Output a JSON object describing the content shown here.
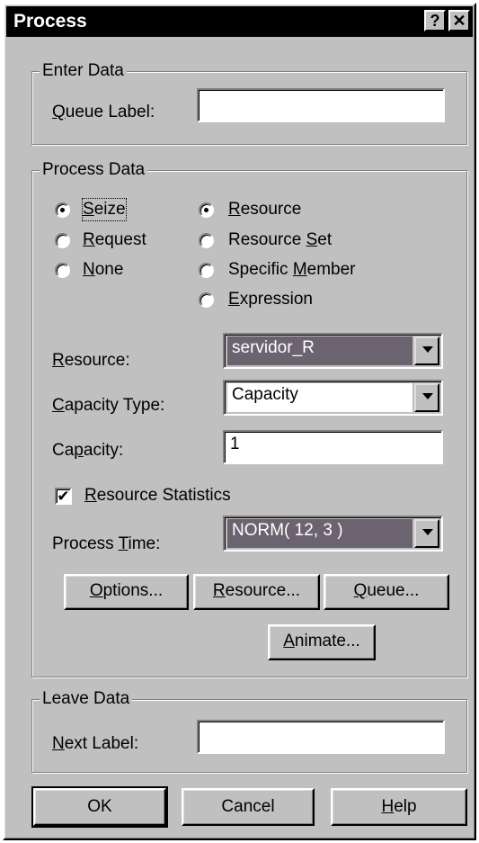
{
  "window": {
    "title": "Process",
    "help_btn": "?",
    "close_btn": "✕"
  },
  "enter_data": {
    "legend": "Enter Data",
    "queue_label": {
      "pre": "",
      "key": "Q",
      "post": "ueue Label:"
    },
    "queue_value": ""
  },
  "process_data": {
    "legend": "Process Data",
    "action_options": [
      {
        "key": "S",
        "post": "eize",
        "selected": true
      },
      {
        "key": "R",
        "post": "equest",
        "selected": false
      },
      {
        "key": "N",
        "post": "one",
        "selected": false
      }
    ],
    "resource_options": [
      {
        "pre": "",
        "key": "R",
        "post": "esource",
        "selected": true
      },
      {
        "pre": "Resource ",
        "key": "S",
        "post": "et",
        "selected": false
      },
      {
        "pre": "Specific ",
        "key": "M",
        "post": "ember",
        "selected": false
      },
      {
        "pre": "",
        "key": "E",
        "post": "xpression",
        "selected": false
      }
    ],
    "resource_label": {
      "pre": "",
      "key": "R",
      "post": "esource:"
    },
    "resource_value": "servidor_R",
    "capacity_type_label": {
      "pre": "",
      "key": "C",
      "post": "apacity Type:"
    },
    "capacity_type_value": "Capacity",
    "capacity_label": {
      "pre": "Ca",
      "key": "p",
      "post": "acity:"
    },
    "capacity_value": "1",
    "resource_statistics": {
      "pre": "",
      "key": "R",
      "post": "esource Statistics",
      "checked": true
    },
    "process_time_label": {
      "pre": "Process ",
      "key": "T",
      "post": "ime:"
    },
    "process_time_value": "NORM( 12, 3 )",
    "buttons": {
      "options": {
        "pre": "",
        "key": "O",
        "post": "ptions..."
      },
      "resource": {
        "pre": "",
        "key": "R",
        "post": "esource..."
      },
      "queue": {
        "pre": "",
        "key": "Q",
        "post": "ueue..."
      },
      "animate": {
        "pre": "",
        "key": "A",
        "post": "nimate..."
      }
    }
  },
  "leave_data": {
    "legend": "Leave Data",
    "next_label": {
      "pre": "",
      "key": "N",
      "post": "ext Label:"
    },
    "next_value": ""
  },
  "footer": {
    "ok": "OK",
    "cancel": "Cancel",
    "help": {
      "pre": "",
      "key": "H",
      "post": "elp"
    }
  },
  "colors": {
    "selected_combo_bg": "#6b6470",
    "face": "#c0c0c0",
    "title_bar": "#000000"
  }
}
